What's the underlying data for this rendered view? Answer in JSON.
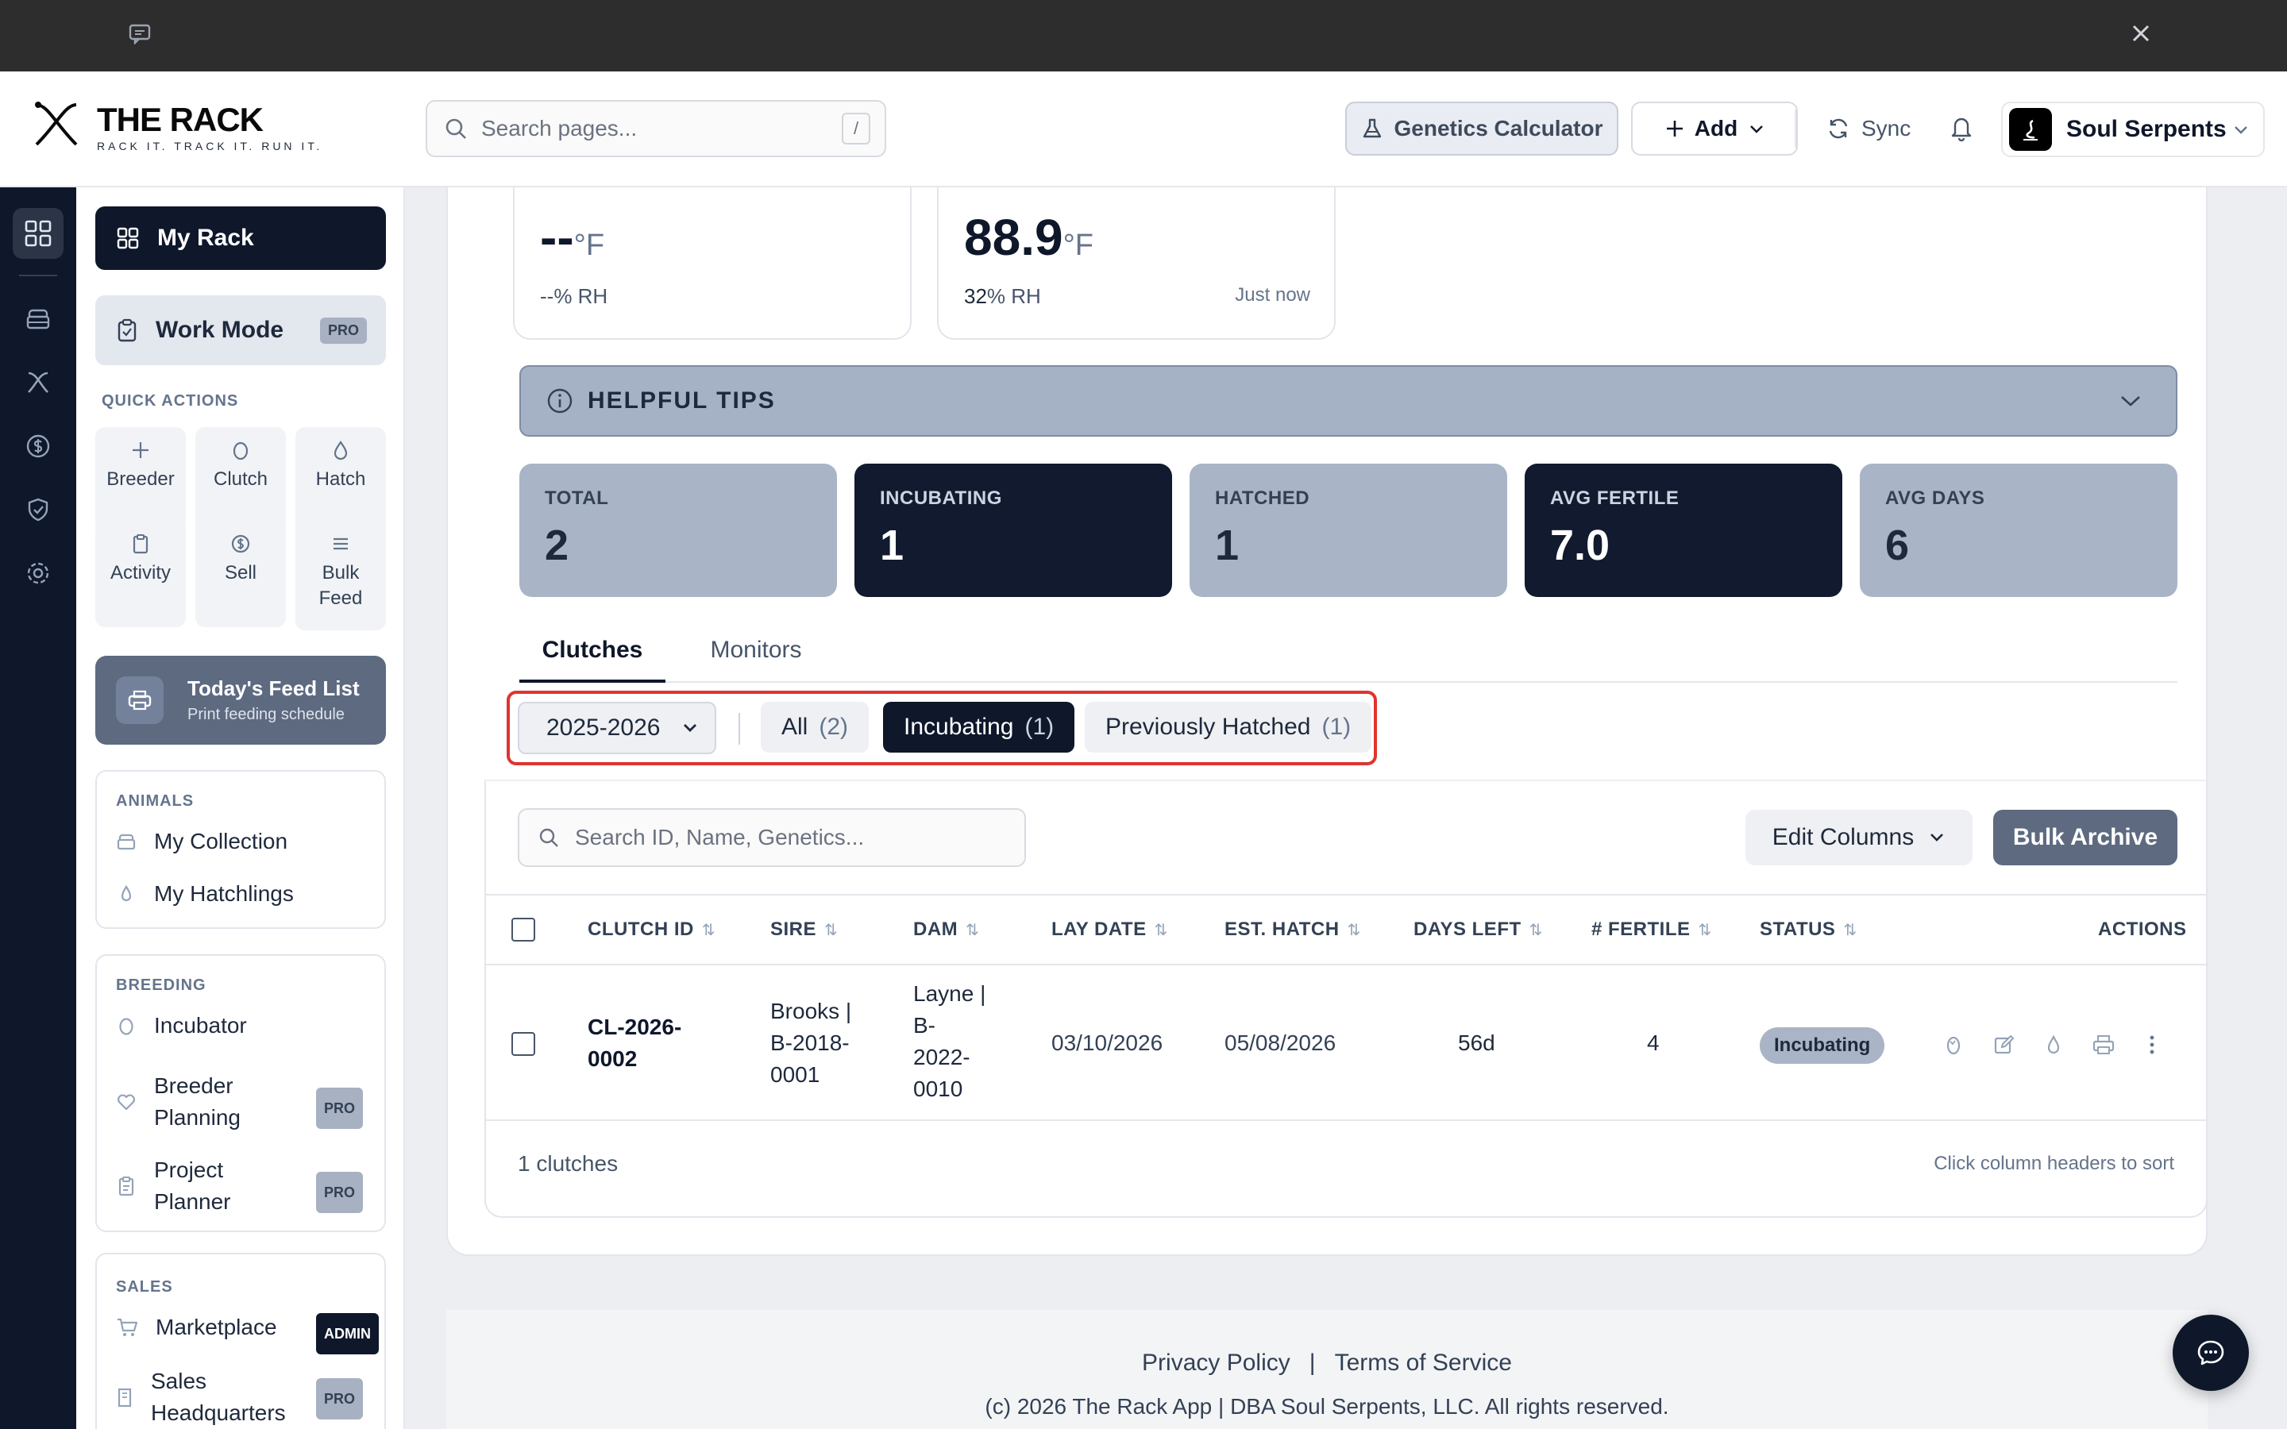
{
  "brand": {
    "name": "THE RACK",
    "tagline": "RACK IT. TRACK IT. RUN IT."
  },
  "header": {
    "search_placeholder": "Search pages...",
    "search_shortcut": "/",
    "genetics_label": "Genetics Calculator",
    "add_label": "Add",
    "sync_label": "Sync",
    "account_name": "Soul Serpents"
  },
  "sidebar": {
    "my_rack": "My Rack",
    "work_mode": "Work Mode",
    "pro_badge": "PRO",
    "admin_badge": "ADMIN",
    "quick_actions_title": "QUICK ACTIONS",
    "quick_actions": [
      {
        "label": "Breeder",
        "icon": "plus-icon"
      },
      {
        "label": "Clutch",
        "icon": "egg-icon"
      },
      {
        "label": "Hatch",
        "icon": "drop-icon"
      },
      {
        "label": "Activity",
        "icon": "clipboard-icon"
      },
      {
        "label": "Sell",
        "icon": "dollar-icon"
      },
      {
        "label": "Bulk\nFeed",
        "icon": "list-icon"
      }
    ],
    "feed_card": {
      "title": "Today's Feed List",
      "subtitle": "Print feeding schedule"
    },
    "animals": {
      "title": "ANIMALS",
      "items": [
        "My Collection",
        "My Hatchlings"
      ]
    },
    "breeding": {
      "title": "BREEDING",
      "items": [
        "Incubator",
        "Breeder\nPlanning",
        "Project\nPlanner"
      ]
    },
    "sales": {
      "title": "SALES",
      "items": [
        "Marketplace",
        "Sales\nHeadquarters"
      ]
    }
  },
  "monitors": [
    {
      "temp": "--",
      "unit": "°F",
      "rh": "--% RH",
      "time": ""
    },
    {
      "temp": "88.9",
      "unit": "°F",
      "rh_value": "32",
      "rh_unit": "% RH",
      "time": "Just now"
    }
  ],
  "tips": {
    "label": "HELPFUL TIPS"
  },
  "stats": [
    {
      "label": "TOTAL",
      "value": "2",
      "style": "light"
    },
    {
      "label": "INCUBATING",
      "value": "1",
      "style": "dark"
    },
    {
      "label": "HATCHED",
      "value": "1",
      "style": "light"
    },
    {
      "label": "AVG FERTILE",
      "value": "7.0",
      "style": "dark"
    },
    {
      "label": "AVG DAYS",
      "value": "6",
      "style": "light"
    }
  ],
  "tabs": [
    "Clutches",
    "Monitors"
  ],
  "filters": {
    "season": "2025-2026",
    "chips": [
      {
        "label": "All",
        "count": "(2)",
        "active": false
      },
      {
        "label": "Incubating",
        "count": "(1)",
        "active": true
      },
      {
        "label": "Previously Hatched",
        "count": "(1)",
        "active": false
      }
    ]
  },
  "table": {
    "search_placeholder": "Search ID, Name, Genetics...",
    "edit_columns": "Edit Columns",
    "bulk_archive": "Bulk Archive",
    "columns": [
      "CLUTCH ID",
      "SIRE",
      "DAM",
      "LAY DATE",
      "EST. HATCH",
      "DAYS LEFT",
      "# FERTILE",
      "STATUS",
      "ACTIONS"
    ],
    "rows": [
      {
        "clutch_id": "CL-2026-\n0002",
        "sire": "Brooks |\nB-2018-\n0001",
        "dam": "Layne |\nB-\n2022-\n0010",
        "lay_date": "03/10/2026",
        "est_hatch": "05/08/2026",
        "days_left": "56d",
        "fertile": "4",
        "status": "Incubating"
      }
    ],
    "count_text": "1 clutches",
    "sort_hint": "Click column headers to sort"
  },
  "footer": {
    "privacy": "Privacy Policy",
    "separator": "|",
    "terms": "Terms of Service",
    "copyright": "(c) 2026 The Rack App | DBA Soul Serpents, LLC. All rights reserved."
  },
  "colors": {
    "navy": "#0f172a",
    "slate": "#5d6a80",
    "chip_light": "#a9b4c6",
    "highlight": "#e0342f"
  }
}
